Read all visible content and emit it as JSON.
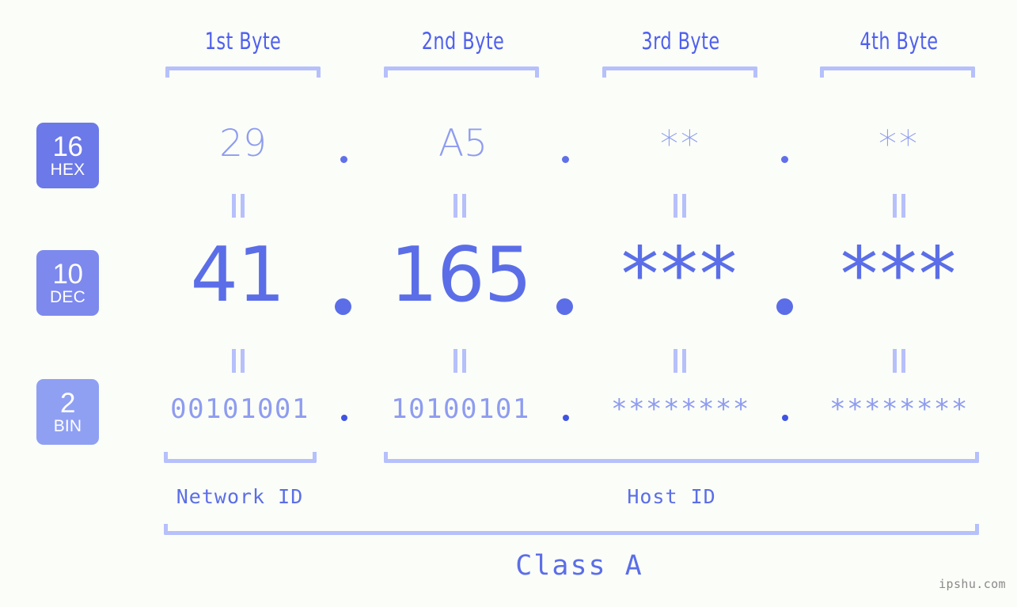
{
  "meta": {
    "background_color": "#fbfdf8",
    "accent_color": "#5b6ee8",
    "accent_light_color": "#8e9cf0",
    "bracket_color": "#b6c0fb"
  },
  "header": {
    "byte_labels": [
      {
        "text": "1st Byte"
      },
      {
        "text": "2nd Byte"
      },
      {
        "text": "3rd Byte"
      },
      {
        "text": "4th Byte"
      }
    ]
  },
  "radix_badges": [
    {
      "number": "16",
      "abbr": "HEX",
      "color": "#6c79e8"
    },
    {
      "number": "10",
      "abbr": "DEC",
      "color": "#7d89ed"
    },
    {
      "number": "2",
      "abbr": "BIN",
      "color": "#8fa0f3"
    }
  ],
  "rows": {
    "hex": {
      "radix": "16",
      "name": "HEX",
      "values": [
        "29",
        "A5",
        "**",
        "**"
      ],
      "separator": "."
    },
    "dec": {
      "radix": "10",
      "name": "DEC",
      "values": [
        "41",
        "165",
        "***",
        "***"
      ],
      "separator": "."
    },
    "bin": {
      "radix": "2",
      "name": "BIN",
      "values": [
        "00101001",
        "10100101",
        "********",
        "********"
      ],
      "separator": "."
    }
  },
  "equivalence_symbol": "=",
  "footer": {
    "network_id_label": "Network ID",
    "host_id_label": "Host ID",
    "class_label": "Class A"
  },
  "watermark": "ipshu.com",
  "chart_data": {
    "type": "table",
    "title": "IP Address Byte Breakdown - Class A",
    "columns": [
      "1st Byte",
      "2nd Byte",
      "3rd Byte",
      "4th Byte"
    ],
    "rows": [
      {
        "radix": 16,
        "label": "HEX",
        "cells": [
          "29",
          "A5",
          "**",
          "**"
        ]
      },
      {
        "radix": 10,
        "label": "DEC",
        "cells": [
          "41",
          "165",
          "***",
          "***"
        ]
      },
      {
        "radix": 2,
        "label": "BIN",
        "cells": [
          "00101001",
          "10100101",
          "********",
          "********"
        ]
      }
    ],
    "groupings": [
      {
        "name": "Network ID",
        "bytes": [
          1
        ]
      },
      {
        "name": "Host ID",
        "bytes": [
          2,
          3,
          4
        ]
      },
      {
        "name": "Class A",
        "bytes": [
          1,
          2,
          3,
          4
        ]
      }
    ]
  }
}
